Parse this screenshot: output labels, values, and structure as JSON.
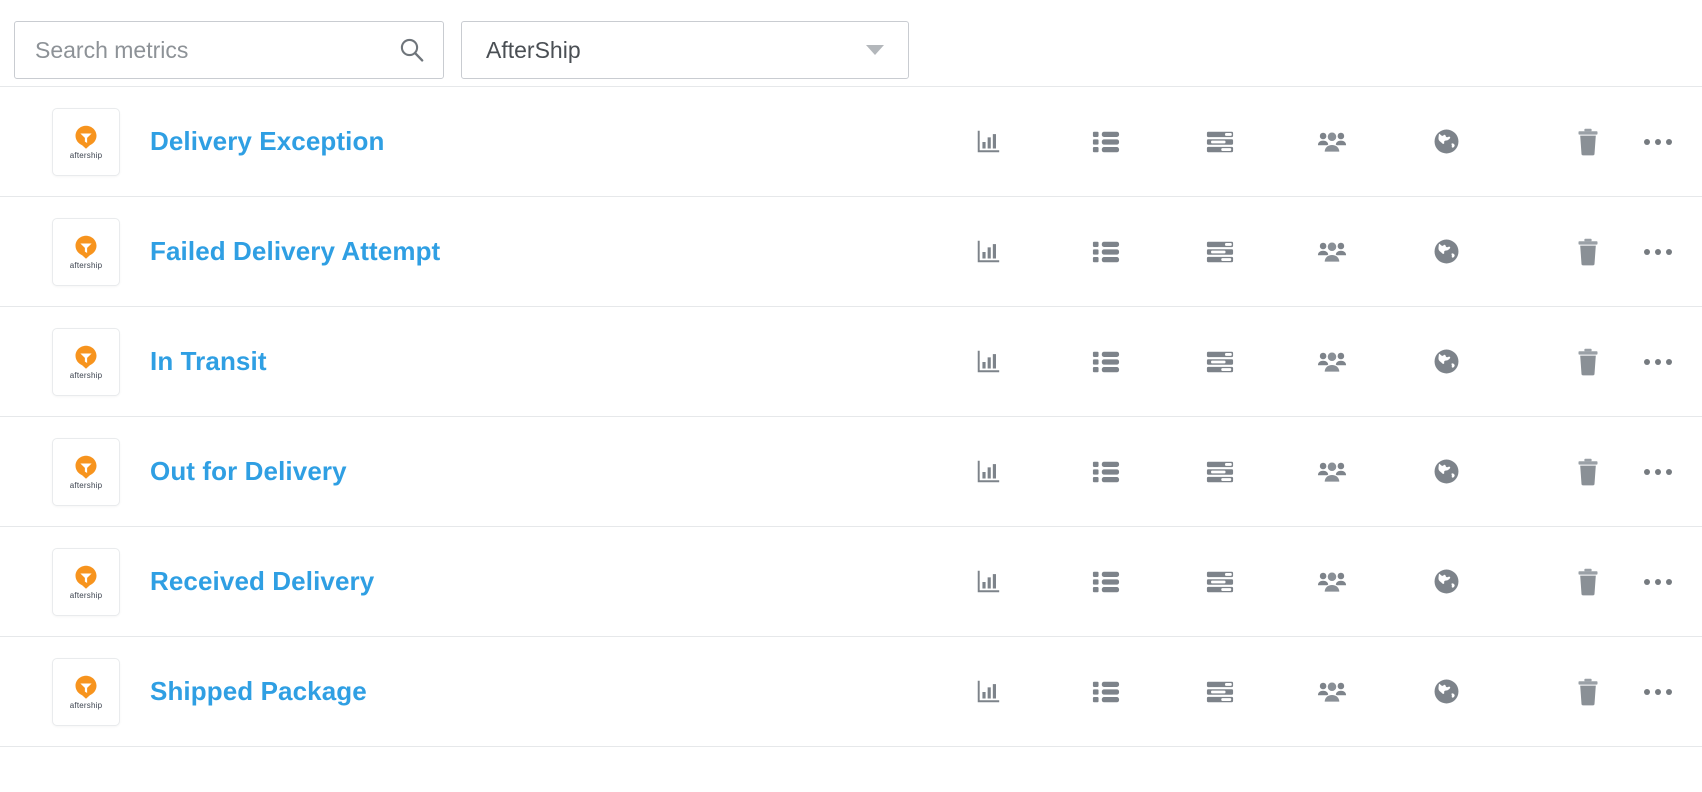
{
  "search": {
    "placeholder": "Search metrics",
    "value": "",
    "icon": "search-icon"
  },
  "integration_filter": {
    "selected": "AfterShip",
    "icon": "chevron-down-icon"
  },
  "colors": {
    "link": "#2f9fe3",
    "icon": "#7d838a",
    "border": "#e6e8ea",
    "logo_orange": "#f7941e",
    "placeholder": "#8d9297"
  },
  "row_actions": [
    {
      "name": "chart-icon",
      "label": "Chart"
    },
    {
      "name": "list-icon",
      "label": "List"
    },
    {
      "name": "tasks-icon",
      "label": "Tasks"
    },
    {
      "name": "users-icon",
      "label": "Users"
    },
    {
      "name": "globe-icon",
      "label": "Globe"
    },
    {
      "name": "trash-icon",
      "label": "Delete"
    },
    {
      "name": "ellipsis-icon",
      "label": "More"
    }
  ],
  "app": {
    "logo_word": "aftership",
    "logo_name": "aftership-logo"
  },
  "metrics": [
    {
      "name": "Delivery Exception"
    },
    {
      "name": "Failed Delivery Attempt"
    },
    {
      "name": "In Transit"
    },
    {
      "name": "Out for Delivery"
    },
    {
      "name": "Received Delivery"
    },
    {
      "name": "Shipped Package"
    }
  ]
}
